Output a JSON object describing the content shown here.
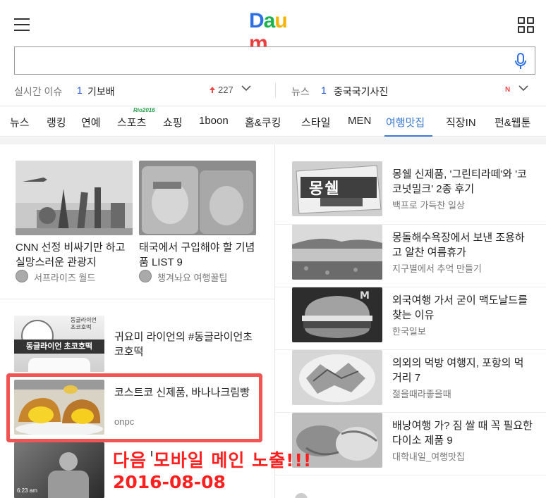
{
  "header": {
    "logo_letters": [
      "D",
      "a",
      "u",
      "m"
    ],
    "logo_colors": [
      "#2f6fe4",
      "#1ab24c",
      "#f5b400",
      "#ea3d3d"
    ]
  },
  "search": {
    "placeholder": "",
    "value": ""
  },
  "trend": {
    "realtime_label": "실시간 이슈",
    "realtime_rank": "1",
    "realtime_keyword": "기보배",
    "realtime_count": "227",
    "news_label": "뉴스",
    "news_rank": "1",
    "news_keyword": "중국국기사진",
    "news_badge": "N"
  },
  "nav": {
    "tabs": [
      "뉴스",
      "랭킹",
      "연예",
      "스포츠",
      "쇼핑",
      "1boon",
      "홈&쿠킹",
      "스타일",
      "MEN",
      "여행맛집",
      "직장IN",
      "펀&웹툰"
    ],
    "active_tab": "여행맛집",
    "sports_badge": "Rio2016",
    "accent": "#3a7ad6"
  },
  "left_top": [
    {
      "title": "CNN 선정 비싸기만 하고 실망스러운 관광지",
      "source": "서프라이즈 월드"
    },
    {
      "title": "태국에서 구입해야 할 기념품 LIST 9",
      "source": "챙겨놔요 여행꿀팁"
    }
  ],
  "left_list": [
    {
      "title": "귀요미 라이언의 #동글라이언초코호떡",
      "thumb_text_1": "동글라이언",
      "thumb_text_2": "초코호떡",
      "thumb_text_3": "동글라이언 초코호떡"
    },
    {
      "title": "코스트코 신제품, 바나나크림빵",
      "source": "onpc"
    }
  ],
  "right_list": [
    {
      "title": "몽쉘 신제품, '그린티라떼'와 '코코넛밀크' 2종 후기",
      "source": "백프로 가득찬 일상",
      "thumb_text": "몽쉘"
    },
    {
      "title": "몽돌해수욕장에서 보낸 조용하고 알찬 여름휴가",
      "source": "지구별에서 추억 만들기"
    },
    {
      "title": "외국여행 가서 굳이 맥도날드를 찾는 이유",
      "source": "한국일보"
    },
    {
      "title": "의외의 먹방 여행지, 포항의 먹거리 7",
      "source": "젊을때라좋을때"
    },
    {
      "title": "배낭여행 가? 짐 쌀 때 꼭 필요한 다이소 제품 9",
      "source": "대학내일_여행맛집"
    }
  ],
  "overlay": {
    "line1": "다음 모바일 메인 노출!!!",
    "line2": "2016-08-08",
    "timestamp": "6:23 am",
    "color": "#ff1f1f"
  }
}
